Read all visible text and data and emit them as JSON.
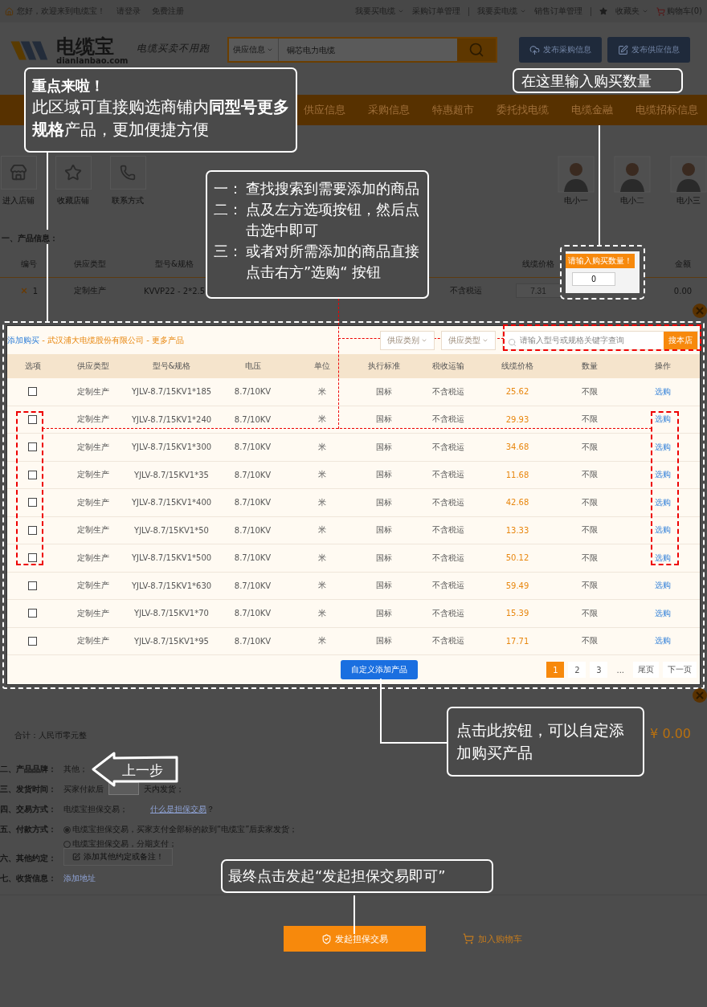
{
  "top_bar": {
    "greeting": "您好，欢迎来到电缆宝！",
    "login": "请登录",
    "register": "免费注册",
    "menus": [
      {
        "label": "我要买电缆",
        "dropdown": true
      },
      {
        "label": "采购订单管理",
        "dropdown": false
      },
      {
        "label": "我要卖电缆",
        "dropdown": true
      },
      {
        "label": "销售订单管理",
        "dropdown": false
      },
      {
        "label": "收藏夹",
        "dropdown": true
      }
    ],
    "cart": "购物车(0)"
  },
  "header": {
    "logo": "电缆宝",
    "logo_domain": "dianlanbao.com",
    "slogan": "电缆买卖不用跑",
    "search_category": "供应信息",
    "search_placeholder": "铜芯电力电缆",
    "buttons": [
      "发布采购信息",
      "发布供应信息"
    ]
  },
  "nav": [
    "供应信息",
    "采购信息",
    "特惠超市",
    "委托找电缆",
    "电缆金融",
    "电缆招标信息"
  ],
  "shop": {
    "actions": [
      "进入店铺",
      "收藏店铺",
      "联系方式"
    ],
    "agents": [
      "电小一",
      "电小二",
      "电小三"
    ]
  },
  "order": {
    "section": "一、产品信息：",
    "columns": [
      "编号",
      "供应类型",
      "型号&规格",
      "线缆价格",
      "金额"
    ],
    "row": {
      "no": "1",
      "type": "定制生产",
      "spec": "KVVP22 - 2*2.5",
      "tax": "不含税运",
      "price": "7.31",
      "amount": "0.00"
    },
    "quantity_tip": "请输入购买数量！",
    "quantity": "0"
  },
  "modal": {
    "title_link": "添加购买",
    "title_rest": " - 武汉浦大电缆股份有限公司 - 更多产品",
    "filters": [
      "供应类别",
      "供应类型"
    ],
    "search_placeholder": "请输入型号或规格关键字查询",
    "search_button": "搜本店",
    "columns": [
      "选项",
      "供应类型",
      "型号&规格",
      "电压",
      "单位",
      "执行标准",
      "税收运输",
      "线缆价格",
      "数量",
      "操作"
    ],
    "rows": [
      {
        "checked": false,
        "type": "定制生产",
        "spec": "YJLV-8.7/15KV1*185",
        "voltage": "8.7/10KV",
        "unit": "米",
        "standard": "国标",
        "tax": "不含税运",
        "price": "25.62",
        "quantity": "不限",
        "action": "选购"
      },
      {
        "checked": false,
        "type": "定制生产",
        "spec": "YJLV-8.7/15KV1*240",
        "voltage": "8.7/10KV",
        "unit": "米",
        "standard": "国标",
        "tax": "不含税运",
        "price": "29.93",
        "quantity": "不限",
        "action": "选购"
      },
      {
        "checked": false,
        "type": "定制生产",
        "spec": "YJLV-8.7/15KV1*300",
        "voltage": "8.7/10KV",
        "unit": "米",
        "standard": "国标",
        "tax": "不含税运",
        "price": "34.68",
        "quantity": "不限",
        "action": "选购"
      },
      {
        "checked": false,
        "type": "定制生产",
        "spec": "YJLV-8.7/15KV1*35",
        "voltage": "8.7/10KV",
        "unit": "米",
        "standard": "国标",
        "tax": "不含税运",
        "price": "11.68",
        "quantity": "不限",
        "action": "选购"
      },
      {
        "checked": false,
        "type": "定制生产",
        "spec": "YJLV-8.7/15KV1*400",
        "voltage": "8.7/10KV",
        "unit": "米",
        "standard": "国标",
        "tax": "不含税运",
        "price": "42.68",
        "quantity": "不限",
        "action": "选购"
      },
      {
        "checked": false,
        "type": "定制生产",
        "spec": "YJLV-8.7/15KV1*50",
        "voltage": "8.7/10KV",
        "unit": "米",
        "standard": "国标",
        "tax": "不含税运",
        "price": "13.33",
        "quantity": "不限",
        "action": "选购"
      },
      {
        "checked": false,
        "type": "定制生产",
        "spec": "YJLV-8.7/15KV1*500",
        "voltage": "8.7/10KV",
        "unit": "米",
        "standard": "国标",
        "tax": "不含税运",
        "price": "50.12",
        "quantity": "不限",
        "action": "选购"
      },
      {
        "checked": false,
        "type": "定制生产",
        "spec": "YJLV-8.7/15KV1*630",
        "voltage": "8.7/10KV",
        "unit": "米",
        "standard": "国标",
        "tax": "不含税运",
        "price": "59.49",
        "quantity": "不限",
        "action": "选购"
      },
      {
        "checked": false,
        "type": "定制生产",
        "spec": "YJLV-8.7/15KV1*70",
        "voltage": "8.7/10KV",
        "unit": "米",
        "standard": "国标",
        "tax": "不含税运",
        "price": "15.39",
        "quantity": "不限",
        "action": "选购"
      },
      {
        "checked": false,
        "type": "定制生产",
        "spec": "YJLV-8.7/15KV1*95",
        "voltage": "8.7/10KV",
        "unit": "米",
        "standard": "国标",
        "tax": "不含税运",
        "price": "17.71",
        "quantity": "不限",
        "action": "选购"
      }
    ],
    "custom_add": "自定义添加产品",
    "pages": [
      {
        "label": "1",
        "selected": true
      },
      {
        "label": "2",
        "selected": false
      },
      {
        "label": "3",
        "selected": false
      }
    ],
    "ellipsis": "...",
    "last": "尾页",
    "next": "下一页"
  },
  "summary": {
    "total_words": "合计：人民币零元整",
    "total": "¥ 0.00"
  },
  "terms": {
    "brand_label": "二、产品品牌：",
    "brand": "其他；",
    "ship_label": "三、发货时间：",
    "ship_before": "买家付款后",
    "ship_after": "天内发货；",
    "trade_label": "四、交易方式：",
    "trade": "电缆宝担保交易；",
    "trade_link": "什么是担保交易",
    "trade_q": "？",
    "pay_label": "五、付款方式：",
    "pay_options": [
      {
        "label": "电缆宝担保交易，买家支付全部标的款到“电缆宝”后卖家发货；",
        "selected": true
      },
      {
        "label": "电缆宝担保交易，分期支付；",
        "selected": false
      }
    ],
    "other_label": "六、其他约定：",
    "other_button": "添加其他约定或备注！",
    "address_label": "七、收货信息：",
    "address_link": "添加地址"
  },
  "actions": {
    "submit": "发起担保交易",
    "cart": "加入购物车"
  },
  "callouts": {
    "highlight_title": "重点来啦！",
    "highlight_text": "此区域可直接购选商铺内**同型号更多规格**产品，更加便捷方便",
    "quantity_hint": "在这里输入购买数量",
    "steps": [
      {
        "marker": "一：",
        "text": "查找搜索到需要添加的商品"
      },
      {
        "marker": "二：",
        "text": "点及左方选项按钮，然后点击选中即可"
      },
      {
        "marker": "三：",
        "text": "或者对所需添加的商品直接点击右方”选购“ 按钮"
      }
    ],
    "custom_hint": "点击此按钮，可以自定添加购买产品",
    "final_hint": "最终点击发起“发起担保交易即可”",
    "back": "上一步"
  }
}
